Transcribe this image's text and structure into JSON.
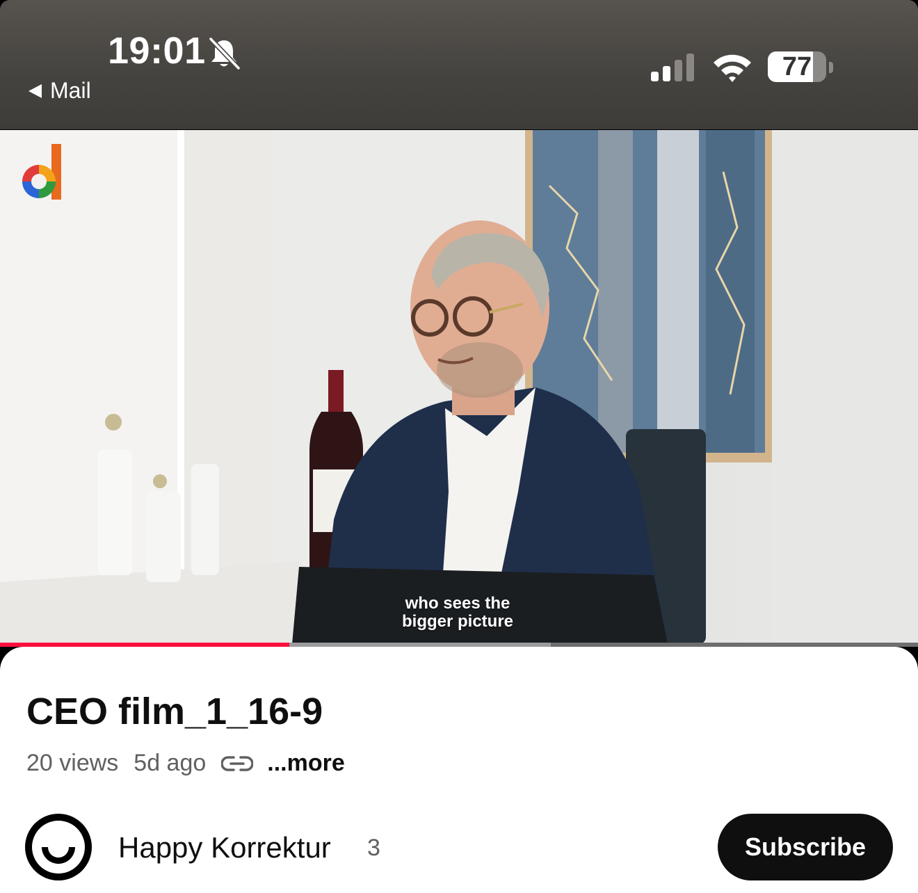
{
  "status_bar": {
    "time": "19:01",
    "back_label": "Mail",
    "battery_percent": "77",
    "battery_level": 0.77,
    "signal_bars_active": 2,
    "icons": [
      "bell-slash-icon",
      "signal-icon",
      "wifi-icon",
      "battery-icon"
    ]
  },
  "video": {
    "caption_line1": "who sees the",
    "caption_line2": "bigger picture",
    "progress_played": 0.315,
    "progress_buffered": 0.6,
    "progress_color": "#ff0f3d"
  },
  "details": {
    "title": "CEO film_1_16-9",
    "views": "20 views",
    "age": "5d ago",
    "more_label": "...more",
    "channel_name": "Happy Korrektur",
    "subscriber_count": "3",
    "subscribe_label": "Subscribe"
  }
}
